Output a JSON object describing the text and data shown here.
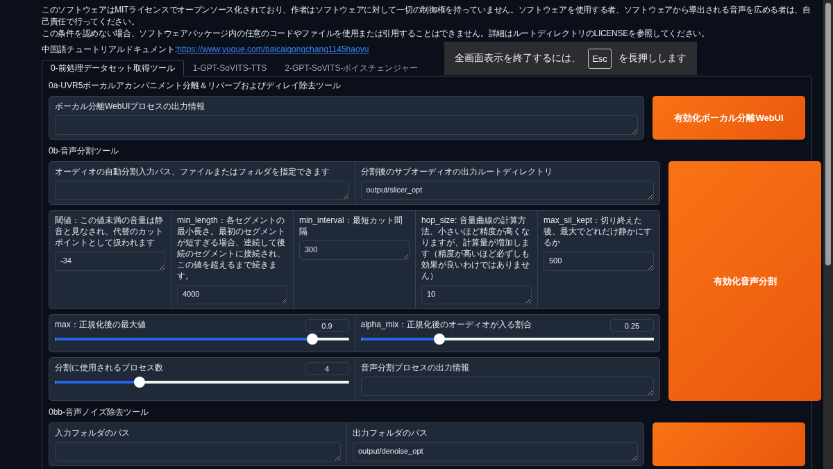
{
  "notice": [
    "このソフトウェアはMITライセンスでオープンソース化されており、作者はソフトウェアに対して一切の制御権を持っていません。ソフトウェアを使用する者、ソフトウェアから導出される音声を広める者は、自己責任で行ってください。",
    "この条件を認めない場合、ソフトウェアパッケージ内の任意のコードやファイルを使用または引用することはできません。詳細はルートディレクトリのLICENSEを参照してください。"
  ],
  "tutorial": {
    "label": "中国語チュートリアルドキュメント: ",
    "link": "https://www.yuque.com/baicaigongchang1145haoyu"
  },
  "fullscreen_toast": {
    "before": "全画面表示を終了するには、",
    "key": "Esc",
    "after": "を長押しします"
  },
  "tabs": [
    {
      "label": "0-前処理データセット取得ツール",
      "selected": true
    },
    {
      "label": "1-GPT-SoVITS-TTS",
      "selected": false
    },
    {
      "label": "2-GPT-SoVITS-ボイスチェンジャー",
      "selected": false
    }
  ],
  "sections": [
    {
      "title": "0a-UVR5ボーカルアカンパニメント分離＆リバーブおよびディレイ除去ツール",
      "button": "有効化ボーカル分離WebUI",
      "rows": [
        {
          "items": [
            {
              "kind": "field",
              "label": "ボーカル分離WebUIプロセスの出力情報"
            }
          ]
        }
      ]
    },
    {
      "title": "0b-音声分割ツール",
      "button": "有効化音声分割",
      "rows": [
        {
          "items": [
            {
              "kind": "field",
              "label": "オーディオの自動分割入力パス、ファイルまたはフォルダを指定できます"
            },
            {
              "kind": "field",
              "label": "分割後のサブオーディオの出力ルートディレクトリ",
              "value": "output/slicer_opt"
            }
          ]
        },
        {
          "items": [
            {
              "kind": "field",
              "label": "閾値：この値未満の音量は静音と見なされ、代替のカットポイントとして扱われます",
              "value": "-34"
            },
            {
              "kind": "field",
              "label": "min_length：各セグメントの最小長さ。最初のセグメントが短すぎる場合、連続して後続のセグメントに接続され、この値を超えるまで続きます。",
              "value": "4000"
            },
            {
              "kind": "field",
              "label": "min_interval：最短カット間隔",
              "value": "300"
            },
            {
              "kind": "field",
              "label": "hop_size: 音量曲線の計算方法、小さいほど精度が高くなりますが、計算量が増加します（精度が高いほど必ずしも効果が良いわけではありません）",
              "value": "10"
            },
            {
              "kind": "field",
              "label": "max_sil_kept：切り終えた後、最大でどれだけ静かにするか",
              "value": "500"
            }
          ]
        },
        {
          "items": [
            {
              "kind": "slider",
              "label": "max：正規化後の最大値",
              "value": "0.9",
              "level": 0.89
            },
            {
              "kind": "slider",
              "label": "alpha_mix：正規化後のオーディオが入る割合",
              "value": "0.25",
              "level": 0.26
            }
          ]
        },
        {
          "items": [
            {
              "kind": "slider",
              "label": "分割に使用されるプロセス数",
              "value": "4",
              "level": 0.28
            },
            {
              "kind": "field",
              "label": "音声分割プロセスの出力情報"
            }
          ]
        }
      ]
    },
    {
      "title": "0bb-音声ノイズ除去ツール",
      "rows": [
        {
          "items": [
            {
              "kind": "field",
              "label": "入力フォルダのパス"
            },
            {
              "kind": "field",
              "label": "出力フォルダのパス",
              "value": "output/denoise_opt"
            }
          ]
        }
      ]
    }
  ]
}
